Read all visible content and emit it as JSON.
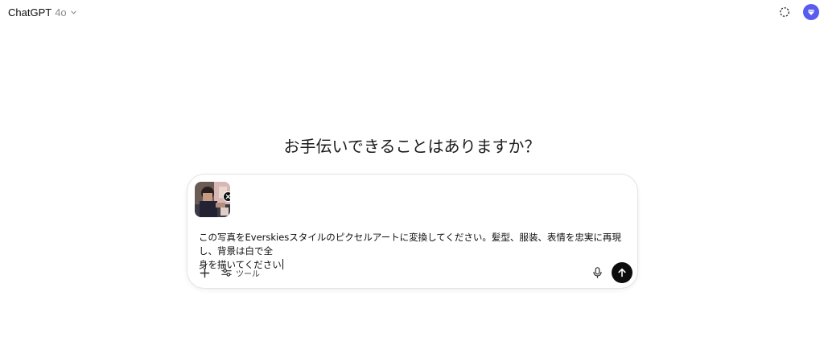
{
  "header": {
    "model_name": "ChatGPT",
    "model_version": "4o",
    "icons": [
      "chevron-down-icon",
      "temporary-chat-icon",
      "user-avatar-icon"
    ],
    "avatar_color": "#5a5cf0"
  },
  "main": {
    "heading": "お手伝いできることはありますか？"
  },
  "composer": {
    "attachment": {
      "type": "image",
      "icon": "remove-attachment-icon"
    },
    "prompt_line1": "この写真をEverskiesスタイルのピクセルアートに変換してください。髪型、服装、表情を忠実に再現し、背景は白で全",
    "prompt_line2": "身を描いてください",
    "tools_label": "ツール",
    "icons": [
      "plus-icon",
      "tools-icon",
      "microphone-icon",
      "arrow-up-icon"
    ],
    "send_color": "#0d0d0d"
  }
}
